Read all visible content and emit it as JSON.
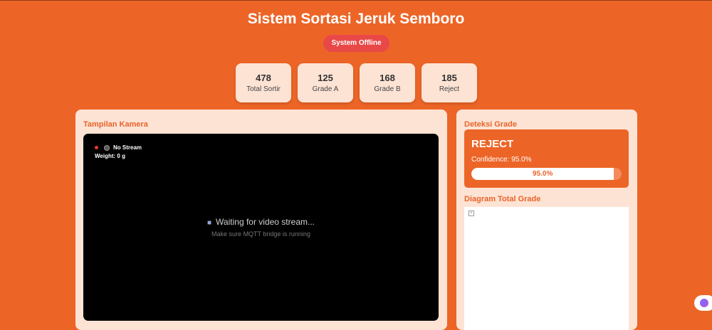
{
  "app": {
    "title": "Sistem Sortasi Jeruk Semboro",
    "status": "System Offline"
  },
  "stats": [
    {
      "value": "478",
      "label": "Total Sortir"
    },
    {
      "value": "125",
      "label": "Grade A"
    },
    {
      "value": "168",
      "label": "Grade B"
    },
    {
      "value": "185",
      "label": "Reject"
    }
  ],
  "camera": {
    "heading": "Tampilan Kamera",
    "stream_status": "No Stream",
    "weight": "Weight: 0 g",
    "waiting": "Waiting for video stream...",
    "hint": "Make sure MQTT bridge is running",
    "icons": {
      "record": "record-dot-icon",
      "camera": "camera-icon",
      "video": "video-camera-icon"
    }
  },
  "detection": {
    "heading": "Deteksi Grade",
    "grade": "REJECT",
    "confidence_text": "Confidence: 95.0%",
    "confidence_value": 0.95,
    "confidence_bar_label": "95.0%"
  },
  "chart": {
    "heading": "Diagram Total Grade",
    "image_icon": "broken-image-icon"
  },
  "colors": {
    "background": "#ec6527",
    "panel": "#fde3d4",
    "offline": "#e94848",
    "accent": "#e8642a"
  }
}
